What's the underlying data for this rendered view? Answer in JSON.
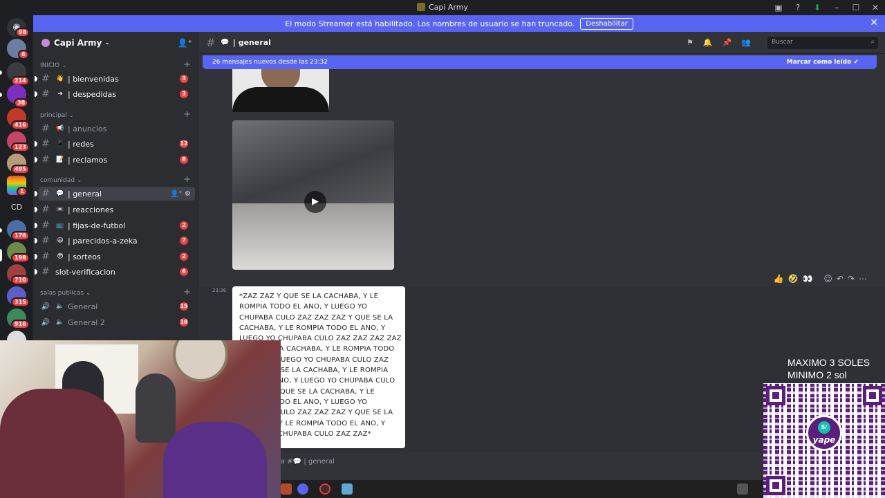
{
  "window": {
    "title": "Capi Army"
  },
  "banner": {
    "text": "El modo Streamer está habilitado. Los nombres de usuario se han truncado.",
    "button": "Deshabilitar"
  },
  "servers": {
    "badges": [
      "98",
      "6",
      "214",
      "38",
      "416",
      "123",
      "495",
      "1",
      "176",
      "198",
      "710",
      "315",
      "916"
    ],
    "text_server": "CD"
  },
  "sidebar": {
    "server_name": "Capi Army",
    "categories": {
      "inicio": "INICIO",
      "principal": "principal",
      "comunidad": "comunidad",
      "salas": "salas publicas"
    },
    "channels": [
      {
        "name": "| bienvenidas",
        "emoji": "👋",
        "count": "3"
      },
      {
        "name": "| despedidas",
        "emoji": "➜",
        "count": "3"
      },
      {
        "name": "| anuncios",
        "emoji": "📢",
        "count": ""
      },
      {
        "name": "| redes",
        "emoji": "📱",
        "count": "12"
      },
      {
        "name": "| reclamos",
        "emoji": "📝",
        "count": "8"
      },
      {
        "name": "| general",
        "emoji": "💬",
        "count": ""
      },
      {
        "name": "| reacciones",
        "emoji": "📼",
        "count": ""
      },
      {
        "name": "| fijas-de-futbol",
        "emoji": "📺",
        "count": "2"
      },
      {
        "name": "| parecidos-a-zeka",
        "emoji": "😃",
        "count": "7"
      },
      {
        "name": "| sorteos",
        "emoji": "😎",
        "count": "2"
      },
      {
        "name": "slot-verificacion",
        "emoji": "",
        "count": "6"
      }
    ],
    "voice": [
      {
        "name": "General",
        "count": "15"
      },
      {
        "name": "General 2",
        "count": "18"
      }
    ]
  },
  "channel_header": {
    "name": "| general",
    "search_placeholder": "Buscar"
  },
  "new_messages": {
    "text": "26 mensajes nuevos desde las 23:32",
    "mark_read": "Marcar como leído"
  },
  "message": {
    "time": "23:36",
    "text": "*ZAZ ZAZ Y QUE SE LA CACHABA, Y LE ROMPIA TODO EL ANO, Y LUEGO YO CHUPABA CULO ZAZ ZAZ ZAZ Y QUE SE LA CACHABA, Y LE ROMPIA TODO EL ANO, Y LUEGO YO CHUPABA CULO ZAZ ZAZ ZAZ ZAZ Y QUE SE LA CACHABA, Y LE ROMPIA TODO EL ANO, Y LUEGO YO CHUPABA CULO ZAZ ZAZ Y QUE SE LA CACHABA, Y LE ROMPIA TODO EL ANO, Y LUEGO YO CHUPABA CULO ZAZ ZAZ Y QUE SE LA CACHABA, Y LE ROMPIA TODO EL ANO, Y LUEGO YO CHUPABA CULO ZAZ ZAZ ZAZ Y QUE SE LA CACHABA, Y LE ROMPIA TODO EL ANO, Y LUEGO YO CHUPABA CULO ZAZ ZAZ*",
    "reply_prefix": "a #",
    "reply_channel": "| general"
  },
  "overlay": {
    "line1": "MAXIMO 3 SOLES",
    "line2": "MINIMO 2 sol",
    "brand": "yape",
    "currency": "S/"
  }
}
